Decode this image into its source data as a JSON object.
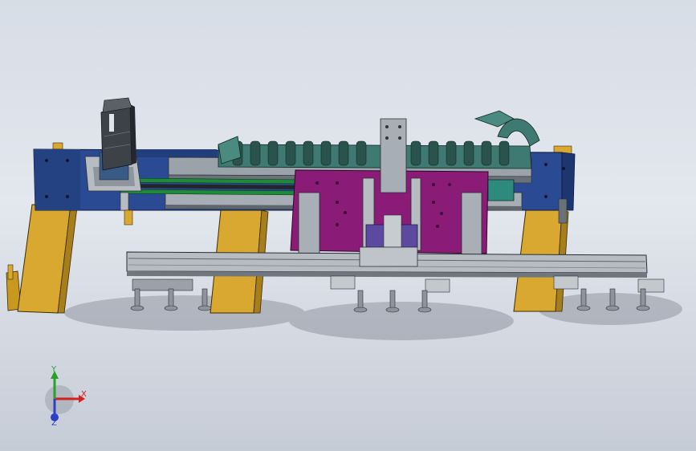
{
  "window": {
    "title": ""
  },
  "colors": {
    "background_top": "#d7dde6",
    "background_bottom": "#c6ccd6",
    "frame_blue": "#2a4b93",
    "support_yellow": "#d8a830",
    "plate_magenta": "#8a1c78",
    "cable_chain_teal": "#3f7a72",
    "rail_green": "#1f8a3a",
    "aluminum_gray": "#a9afb6",
    "motor_dark": "#3d4248",
    "axis_x": "#d32020",
    "axis_y": "#2aa02a",
    "axis_z": "#2b3fc9"
  },
  "triad": {
    "x": "X",
    "y": "Y",
    "z": "Z"
  }
}
